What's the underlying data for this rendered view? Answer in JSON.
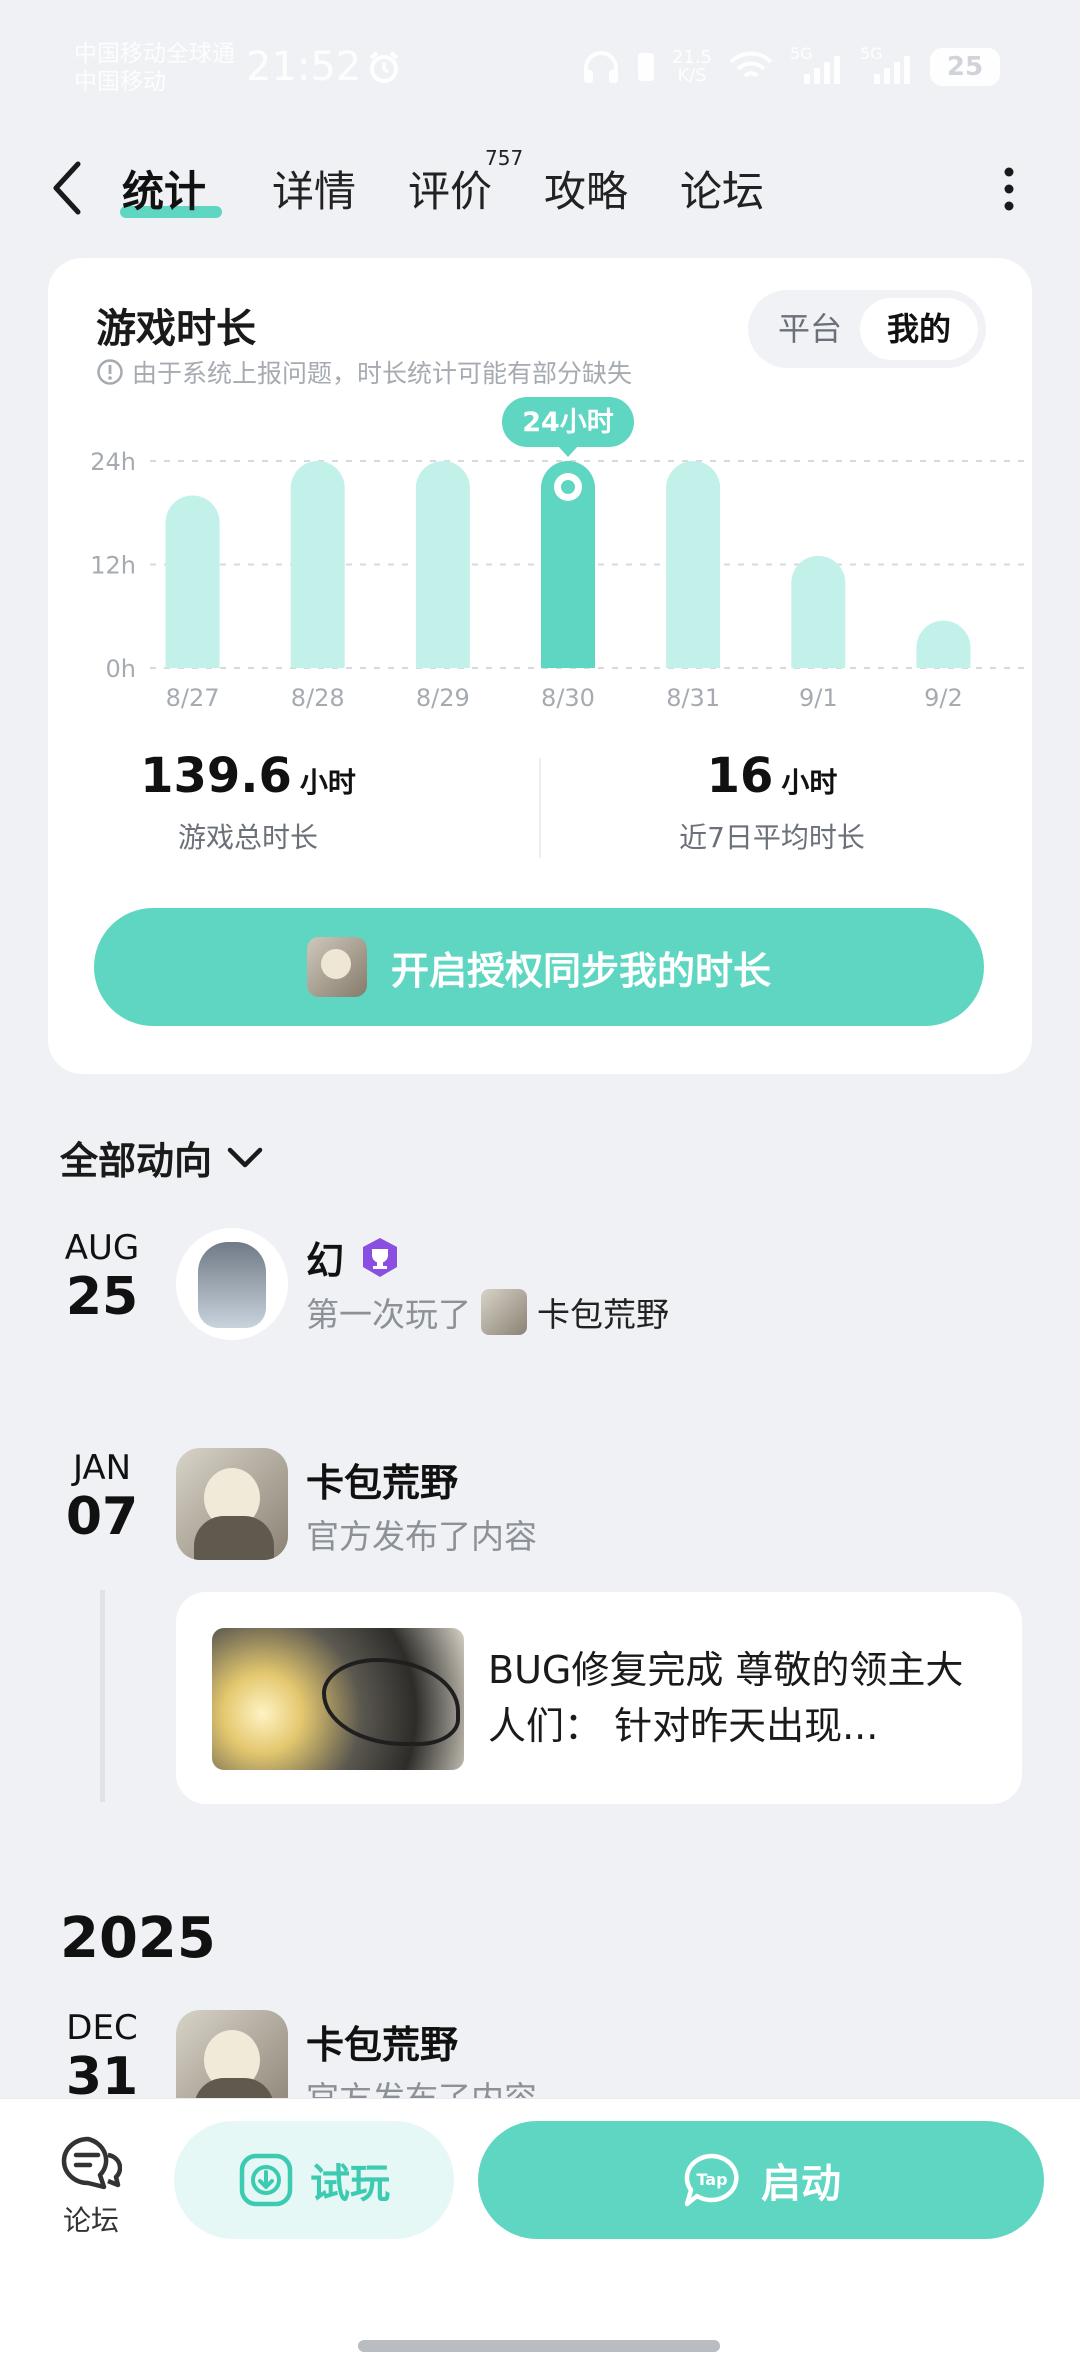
{
  "status_bar": {
    "carrier_line1": "中国移动全球通",
    "carrier_line2": "中国移动",
    "time": "21:52",
    "net_speed_value": "21.5",
    "net_speed_unit": "K/S",
    "signal1_label": "5G",
    "signal2_label": "5G",
    "battery": "25"
  },
  "nav": {
    "tabs": [
      {
        "label": "统计",
        "active": true
      },
      {
        "label": "详情"
      },
      {
        "label": "评价",
        "badge": "757"
      },
      {
        "label": "攻略"
      },
      {
        "label": "论坛"
      }
    ]
  },
  "stats_card": {
    "title": "游戏时长",
    "note": "由于系统上报问题，时长统计可能有部分缺失",
    "toggle": {
      "left": "平台",
      "right": "我的",
      "selected": "我的"
    },
    "total_value": "139.6",
    "total_unit": "小时",
    "total_label": "游戏总时长",
    "avg_value": "16",
    "avg_unit": "小时",
    "avg_label": "近7日平均时长",
    "sync_button": "开启授权同步我的时长"
  },
  "chart_data": {
    "type": "bar",
    "categories": [
      "8/27",
      "8/28",
      "8/29",
      "8/30",
      "8/31",
      "9/1",
      "9/2"
    ],
    "values": [
      20,
      24,
      24,
      24,
      24,
      13,
      5.5
    ],
    "unit": "h",
    "yticks": [
      "0h",
      "12h",
      "24h"
    ],
    "ylim": [
      0,
      24
    ],
    "highlight_index": 3,
    "highlight_label": "24小时",
    "bar_color": "#c2f1ea",
    "highlight_color": "#5fd6c1",
    "grid": true
  },
  "feed": {
    "header": "全部动向",
    "items": [
      {
        "month": "AUG",
        "day": "25",
        "name": "幻",
        "action": "第一次玩了",
        "game": "卡包荒野"
      },
      {
        "month": "JAN",
        "day": "07",
        "name": "卡包荒野",
        "action": "官方发布了内容",
        "post_text": "BUG修复完成 尊敬的领主大人们： 针对昨天出现..."
      }
    ],
    "year": "2025",
    "next_item": {
      "month": "DEC",
      "day": "31",
      "name": "卡包荒野",
      "action": "官方发布了内容"
    }
  },
  "bottom_bar": {
    "forum_label": "论坛",
    "try_label": "试玩",
    "launch_label": "启动",
    "launch_logo_text": "Tap"
  },
  "colors": {
    "accent": "#5fd6c1",
    "accent_light": "#c2f1ea",
    "background": "#eff1f4"
  }
}
